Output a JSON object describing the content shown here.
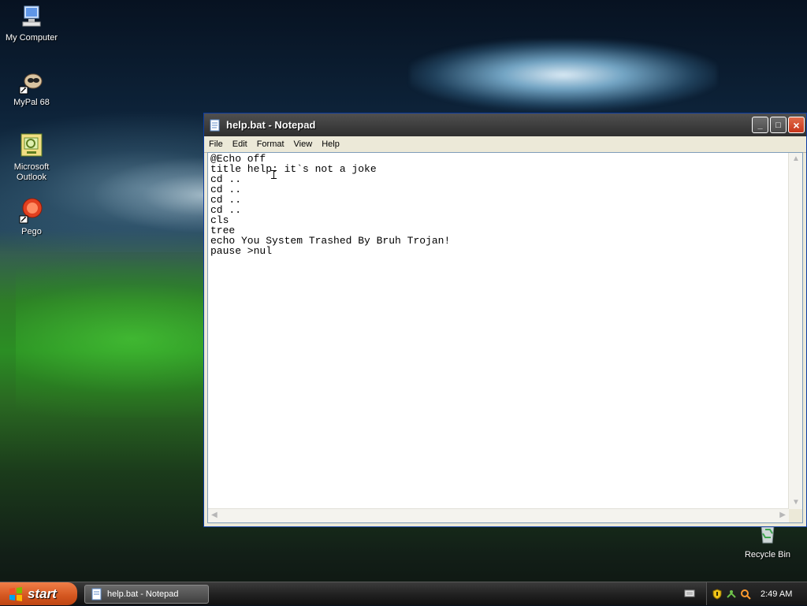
{
  "desktop": {
    "icons": [
      {
        "label": "My Computer"
      },
      {
        "label": "MyPal 68"
      },
      {
        "label": "Microsoft Outlook"
      },
      {
        "label": "Pego"
      },
      {
        "label": "Recycle Bin"
      }
    ]
  },
  "window": {
    "title": "help.bat - Notepad",
    "menu": [
      "File",
      "Edit",
      "Format",
      "View",
      "Help"
    ],
    "content": "@Echo off\ntitle help: it`s not a joke\ncd ..\ncd ..\ncd ..\ncd ..\ncls\ntree\necho You System Trashed By Bruh Trojan!\npause >nul"
  },
  "taskbar": {
    "start_label": "start",
    "task_label": "help.bat - Notepad",
    "clock": "2:49 AM"
  },
  "colors": {
    "start_orange": "#d3561f",
    "close_red": "#c6351b"
  },
  "icons": {
    "window": "notepad-icon",
    "task": "notepad-icon",
    "tray": [
      "shield-icon",
      "network-icon",
      "magnifier-icon"
    ]
  }
}
